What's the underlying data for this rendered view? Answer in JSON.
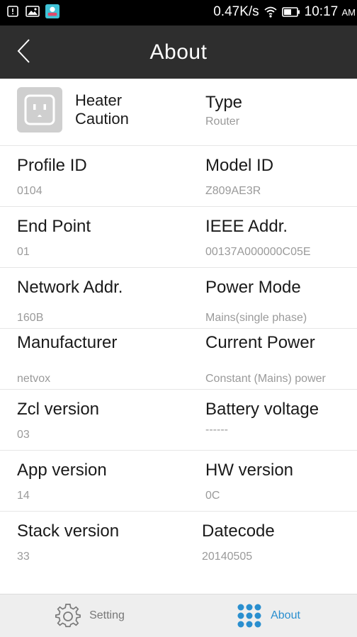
{
  "status_bar": {
    "network_speed": "0.47K/s",
    "time": "10:17",
    "ampm": "AM"
  },
  "header": {
    "title": "About"
  },
  "device": {
    "name": "Heater\nCaution",
    "icon": "power-outlet-icon"
  },
  "rows": [
    {
      "left": {
        "label": "",
        "value": ""
      },
      "right": {
        "label": "Type",
        "value": "Router"
      }
    },
    {
      "left": {
        "label": "Profile ID",
        "value": "0104"
      },
      "right": {
        "label": "Model ID",
        "value": "Z809AE3R"
      }
    },
    {
      "left": {
        "label": "End Point",
        "value": "01"
      },
      "right": {
        "label": "IEEE Addr.",
        "value": "00137A000000C05E"
      }
    },
    {
      "left": {
        "label": "Network Addr.",
        "value": "160B"
      },
      "right": {
        "label": "Power Mode",
        "value": "Mains(single phase)"
      }
    },
    {
      "left": {
        "label": "Manufacturer",
        "value": "netvox"
      },
      "right": {
        "label": "Current Power",
        "value": "Constant (Mains) power"
      }
    },
    {
      "left": {
        "label": "Zcl version",
        "value": "03"
      },
      "right": {
        "label": "Battery voltage",
        "value": "------"
      }
    },
    {
      "left": {
        "label": "App version",
        "value": "14"
      },
      "right": {
        "label": "HW version",
        "value": "0C"
      }
    },
    {
      "left": {
        "label": "Stack version",
        "value": "33"
      },
      "right": {
        "label": "Datecode",
        "value": "20140505"
      }
    }
  ],
  "bottom_nav": {
    "setting_label": "Setting",
    "about_label": "About",
    "active_color": "#2a8fcf",
    "inactive_color": "#777777"
  }
}
